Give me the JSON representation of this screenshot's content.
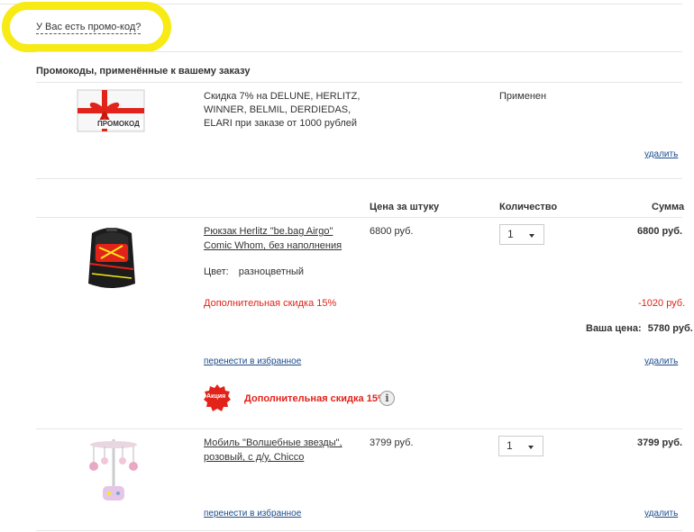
{
  "promo_question": "У Вас есть промо-код?",
  "applied_section": {
    "title": "Промокоды, применённые к вашему заказу",
    "promo": {
      "image_label": "ПРОМОКОД",
      "description_lines": [
        "Скидка 7% на DELUNE, HERLITZ,",
        "WINNER, BELMIL, DERDIEDAS,",
        "ELARI при заказе от 1000 рублей"
      ],
      "status": "Применен",
      "remove": "удалить"
    }
  },
  "columns": {
    "price": "Цена за штуку",
    "quantity": "Количество",
    "sum": "Сумма"
  },
  "items": [
    {
      "name_lines": [
        "Рюкзак Herlitz \"be.bag Airgo\"",
        "Comic Whom, без наполнения"
      ],
      "price": "6800 руб.",
      "quantity": "1",
      "sum": "6800 руб.",
      "color_label": "Цвет:",
      "color_value": "разноцветный",
      "discount_label": "Дополнительная скидка 15%",
      "discount_value": "-1020 руб.",
      "your_price_label": "Ваша цена:",
      "your_price_value": "5780 руб.",
      "to_favorites": "перенести в избранное",
      "remove": "удалить",
      "promo_badge": "Акция",
      "promo_text": "Дополнительная скидка 15%",
      "info_icon": "i"
    },
    {
      "name_lines": [
        "Мобиль \"Волшебные звезды\",",
        "розовый, с д/у, Chicco"
      ],
      "price": "3799 руб.",
      "quantity": "1",
      "sum": "3799 руб.",
      "to_favorites": "перенести в избранное",
      "remove": "удалить"
    }
  ],
  "colors": {
    "accent_red": "#e2231a",
    "link_blue": "#1a4b8c",
    "highlight_yellow": "#f7ea15"
  }
}
